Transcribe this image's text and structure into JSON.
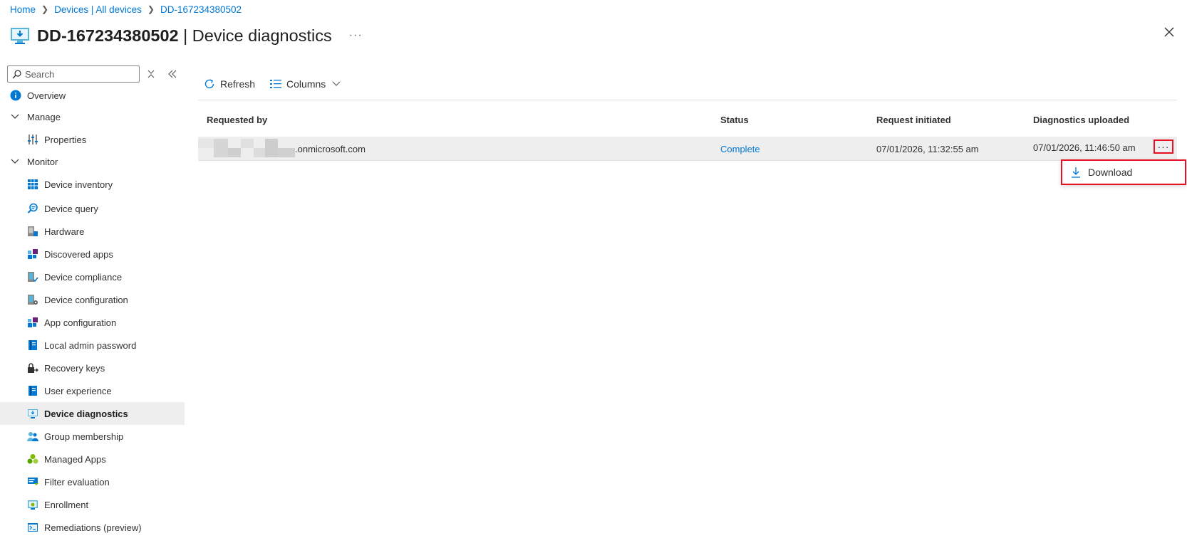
{
  "breadcrumb": [
    "Home",
    "Devices | All devices",
    "DD-167234380502"
  ],
  "title": {
    "device": "DD-167234380502",
    "suffix": " | Device diagnostics",
    "more": "···"
  },
  "search": {
    "placeholder": "Search"
  },
  "nav": {
    "overview": "Overview",
    "manage": "Manage",
    "properties": "Properties",
    "monitor": "Monitor",
    "items": [
      "Device inventory",
      "Device query",
      "Hardware",
      "Discovered apps",
      "Device compliance",
      "Device configuration",
      "App configuration",
      "Local admin password",
      "Recovery keys",
      "User experience",
      "Device diagnostics",
      "Group membership",
      "Managed Apps",
      "Filter evaluation",
      "Enrollment",
      "Remediations (preview)"
    ]
  },
  "toolbar": {
    "refresh": "Refresh",
    "columns": "Columns"
  },
  "table": {
    "headers": [
      "Requested by",
      "Status",
      "Request initiated",
      "Diagnostics uploaded"
    ],
    "rows": [
      {
        "requested_by": ".onmicrosoft.com",
        "status": "Complete",
        "initiated": "07/01/2026, 11:32:55 am",
        "uploaded": "07/01/2026, 11:46:50 am",
        "more": "···"
      }
    ]
  },
  "context_menu": {
    "download": "Download"
  },
  "colors": {
    "accent": "#0078d4",
    "highlight": "#e81123",
    "selected": "#eeeeee"
  }
}
